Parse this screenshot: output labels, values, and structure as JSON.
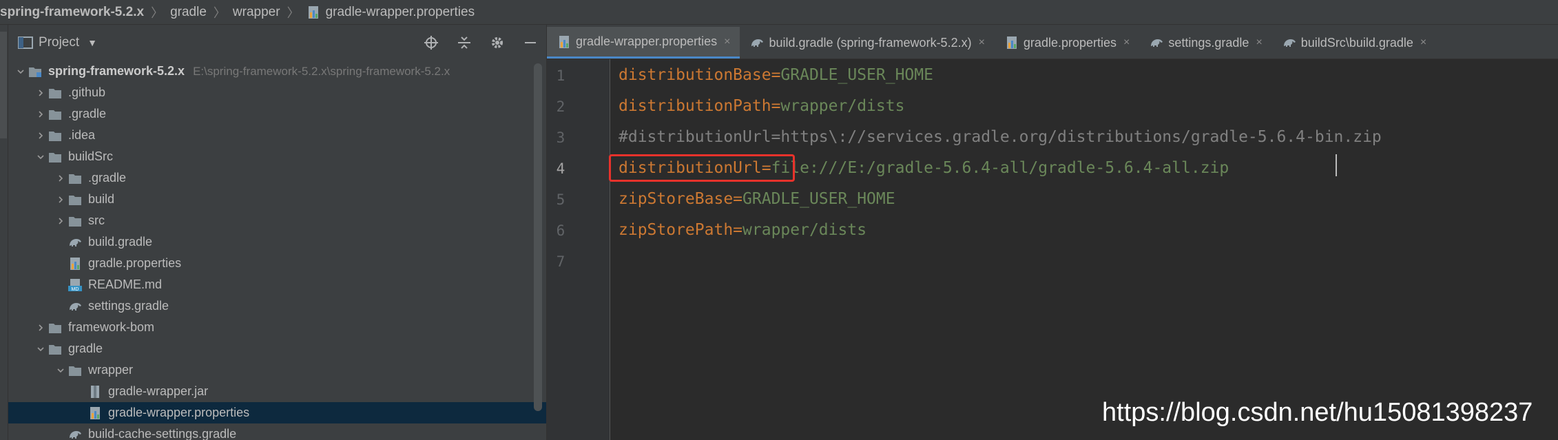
{
  "breadcrumb": {
    "items": [
      "spring-framework-5.2.x",
      "gradle",
      "wrapper",
      "gradle-wrapper.properties"
    ],
    "separator": "〉"
  },
  "project_panel": {
    "title": "Project",
    "tree": [
      {
        "label": "spring-framework-5.2.x",
        "path": "E:\\spring-framework-5.2.x\\spring-framework-5.2.x",
        "icon": "module-folder-icon",
        "expanded": true
      },
      {
        "label": ".github",
        "icon": "folder-icon",
        "expanded": false
      },
      {
        "label": ".gradle",
        "icon": "folder-icon",
        "expanded": false
      },
      {
        "label": ".idea",
        "icon": "folder-icon",
        "expanded": false
      },
      {
        "label": "buildSrc",
        "icon": "folder-icon",
        "expanded": true
      },
      {
        "label": ".gradle",
        "icon": "folder-icon",
        "expanded": false
      },
      {
        "label": "build",
        "icon": "folder-icon",
        "expanded": false
      },
      {
        "label": "src",
        "icon": "folder-icon",
        "expanded": false
      },
      {
        "label": "build.gradle",
        "icon": "gradle-elephant-icon"
      },
      {
        "label": "gradle.properties",
        "icon": "properties-file-icon"
      },
      {
        "label": "README.md",
        "icon": "markdown-file-icon"
      },
      {
        "label": "settings.gradle",
        "icon": "gradle-elephant-icon"
      },
      {
        "label": "framework-bom",
        "icon": "folder-icon",
        "expanded": false
      },
      {
        "label": "gradle",
        "icon": "folder-icon",
        "expanded": true
      },
      {
        "label": "wrapper",
        "icon": "folder-icon",
        "expanded": true
      },
      {
        "label": "gradle-wrapper.jar",
        "icon": "jar-file-icon"
      },
      {
        "label": "gradle-wrapper.properties",
        "icon": "properties-file-icon",
        "selected": true
      },
      {
        "label": "build-cache-settings.gradle",
        "icon": "gradle-elephant-icon"
      }
    ]
  },
  "tabs": [
    {
      "label": "gradle-wrapper.properties",
      "icon": "properties-file-icon",
      "active": true
    },
    {
      "label": "build.gradle (spring-framework-5.2.x)",
      "icon": "gradle-elephant-icon",
      "active": false
    },
    {
      "label": "gradle.properties",
      "icon": "properties-file-icon",
      "active": false
    },
    {
      "label": "settings.gradle",
      "icon": "gradle-elephant-icon",
      "active": false
    },
    {
      "label": "buildSrc\\build.gradle",
      "icon": "gradle-elephant-icon",
      "active": false
    }
  ],
  "editor": {
    "current_line": 4,
    "lines": [
      {
        "n": "1",
        "key": "distributionBase",
        "eq": "=",
        "value": "GRADLE_USER_HOME"
      },
      {
        "n": "2",
        "key": "distributionPath",
        "eq": "=",
        "value": "wrapper/dists"
      },
      {
        "n": "3",
        "comment": "#distributionUrl=https\\://services.gradle.org/distributions/gradle-5.6.4-bin.zip"
      },
      {
        "n": "4",
        "key": "distributionUrl",
        "eq": "=",
        "value": "file:///E:/gradle-5.6.4-all/gradle-5.6.4-all.zip"
      },
      {
        "n": "5",
        "key": "zipStoreBase",
        "eq": "=",
        "value": "GRADLE_USER_HOME"
      },
      {
        "n": "6",
        "key": "zipStorePath",
        "eq": "=",
        "value": "wrapper/dists"
      },
      {
        "n": "7"
      }
    ]
  },
  "watermark": "https://blog.csdn.net/hu15081398237",
  "colors": {
    "key": "#cc7832",
    "value": "#6a8759",
    "comment": "#808080",
    "highlight_box": "#e8322b",
    "selection": "#0d293e",
    "active_tab_underline": "#4a88c7"
  }
}
